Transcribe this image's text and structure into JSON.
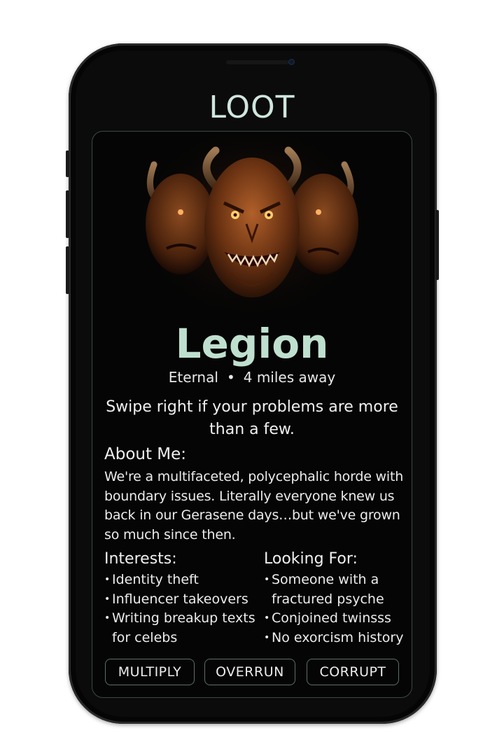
{
  "app": {
    "title": "LOOT"
  },
  "profile": {
    "image_icon": "demon-portrait-image",
    "name": "Legion",
    "status": "Eternal",
    "separator": "•",
    "distance": "4 miles away",
    "tagline": "Swipe right if your problems are more than a few."
  },
  "about": {
    "heading": "About Me:",
    "text": "We're a multifaceted, polycephalic horde with boundary issues. Literally everyone knew us back in our Gerasene days…but we've grown so much since then."
  },
  "interests": {
    "heading": "Interests:",
    "items": [
      "Identity theft",
      "Influencer takeovers",
      "Writing breakup texts for celebs"
    ]
  },
  "looking_for": {
    "heading": "Looking For:",
    "items": [
      "Someone with a fractured psyche",
      "Conjoined twinsss",
      "No exorcism history"
    ]
  },
  "actions": {
    "multiply": "MULTIPLY",
    "overrun": "OVERRUN",
    "corrupt": "CORRUPT"
  },
  "colors": {
    "accent": "#bfe0cf",
    "card_border": "#3b4a45",
    "background": "#050505"
  }
}
